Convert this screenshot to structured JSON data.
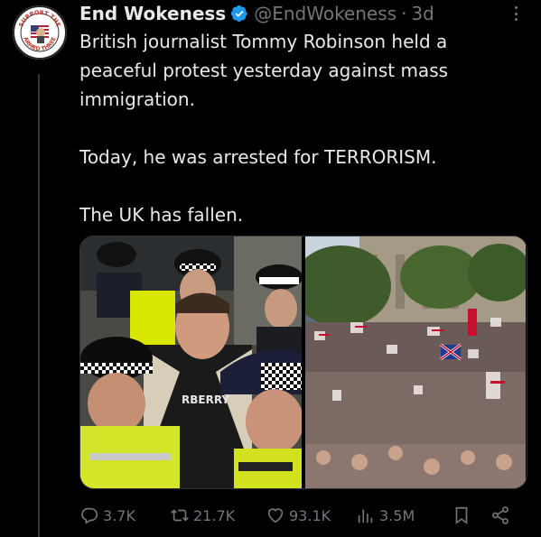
{
  "post": {
    "author_name": "End Wokeness",
    "handle": "@EndWokeness",
    "separator": "·",
    "time": "3d",
    "avatar_text": {
      "top": "SUPPORT THE",
      "bottom": "ARMED THREE"
    },
    "text_lines": [
      "British journalist Tommy Robinson held a",
      "peaceful protest yesterday against mass",
      "immigration.",
      "",
      "Today, he was arrested for TERRORISM.",
      "",
      "The UK has fallen."
    ],
    "media": {
      "left_shirt_text": "RBERRY"
    }
  },
  "actions": {
    "replies": "3.7K",
    "reposts": "21.7K",
    "likes": "93.1K",
    "views": "3.5M"
  },
  "icons": [
    "more-icon",
    "verified-badge-icon",
    "reply-icon",
    "repost-icon",
    "like-icon",
    "views-icon",
    "bookmark-icon",
    "share-icon"
  ],
  "colors": {
    "background": "#000000",
    "text": "#e7e9ea",
    "muted": "#71767b",
    "verified": "#1d9bf0"
  }
}
